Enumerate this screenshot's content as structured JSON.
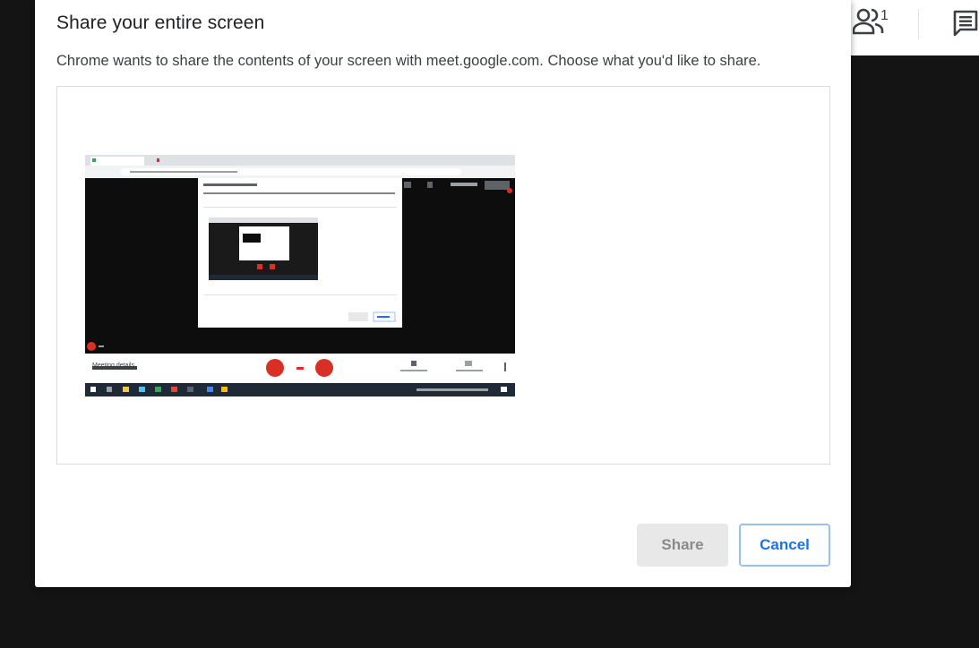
{
  "dialog": {
    "title": "Share your entire screen",
    "description": "Chrome wants to share the contents of your screen with meet.google.com. Choose what you'd like to share.",
    "share_label": "Share",
    "cancel_label": "Cancel"
  },
  "meet_toolbar": {
    "participant_count": "1",
    "people_icon": "people-icon",
    "chat_icon": "chat-icon"
  },
  "thumbnail": {
    "meeting_details_label": "Meeting details",
    "mic_button_color": "#d93025",
    "colors": {
      "accent": "#1a73e8",
      "danger": "#d93025",
      "taskbar": "#1f2a36"
    }
  }
}
